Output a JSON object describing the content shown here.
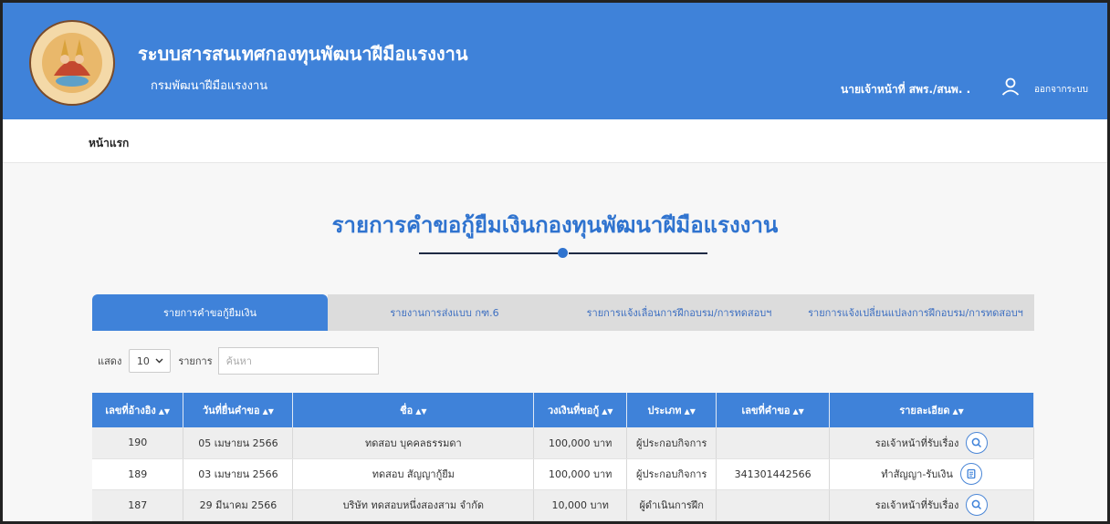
{
  "header": {
    "title": "ระบบสารสนเทศกองทุนพัฒนาฝีมือแรงงาน",
    "subtitle": "กรมพัฒนาฝีมือแรงงาน",
    "user_name": "นายเจ้าหน้าที่ สพร./สนพ. .",
    "logout": "ออกจากระบบ"
  },
  "breadcrumb": {
    "home": "หน้าแรก"
  },
  "page": {
    "title": "รายการคำขอกู้ยืมเงินกองทุนพัฒนาฝีมือแรงงาน"
  },
  "tabs": [
    {
      "label": "รายการคำขอกู้ยืมเงิน",
      "active": true
    },
    {
      "label": "รายงานการส่งแบบ กฑ.6",
      "active": false
    },
    {
      "label": "รายการแจ้งเลื่อนการฝึกอบรม/การทดสอบฯ",
      "active": false
    },
    {
      "label": "รายการแจ้งเปลี่ยนแปลงการฝึกอบรม/การทดสอบฯ",
      "active": false
    }
  ],
  "controls": {
    "show_label": "แสดง",
    "page_size": "10",
    "items_label": "รายการ",
    "search_placeholder": "ค้นหา"
  },
  "table": {
    "columns": [
      "เลขที่อ้างอิง",
      "วันที่ยื่นคำขอ",
      "ชื่อ",
      "วงเงินที่ขอกู้",
      "ประเภท",
      "เลขที่คำขอ",
      "รายละเอียด"
    ],
    "rows": [
      {
        "ref": "190",
        "date": "05 เมษายน 2566",
        "name": "ทดสอบ บุคคลธรรมดา",
        "amount": "100,000 บาท",
        "type": "ผู้ประกอบกิจการ",
        "req_no": "",
        "status": "รอเจ้าหน้าที่รับเรื่อง",
        "icon": "search-icon"
      },
      {
        "ref": "189",
        "date": "03 เมษายน 2566",
        "name": "ทดสอบ สัญญากู้ยืม",
        "amount": "100,000 บาท",
        "type": "ผู้ประกอบกิจการ",
        "req_no": "341301442566",
        "status": "ทำสัญญา-รับเงิน",
        "icon": "document-icon"
      },
      {
        "ref": "187",
        "date": "29 มีนาคม 2566",
        "name": "บริษัท ทดสอบหนึ่งสองสาม จำกัด",
        "amount": "10,000 บาท",
        "type": "ผู้ดำเนินการฝึก",
        "req_no": "",
        "status": "รอเจ้าหน้าที่รับเรื่อง",
        "icon": "search-icon"
      }
    ]
  },
  "colors": {
    "primary": "#3f82d9",
    "tab_inactive": "#dcdcdc",
    "title": "#2f73cf"
  }
}
